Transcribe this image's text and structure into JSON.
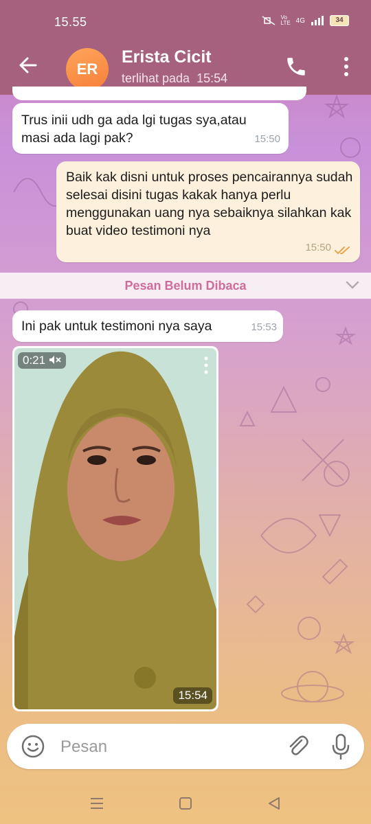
{
  "status_bar": {
    "time": "15.55",
    "battery": "34",
    "network": "4G",
    "volte": "Vo LTE"
  },
  "header": {
    "back_icon": "arrow-left-icon",
    "avatar_initials": "ER",
    "name": "Erista Cicit",
    "last_seen_label": "terlihat pada",
    "last_seen_time": "15:54",
    "call_icon": "phone-icon",
    "menu_icon": "more-vertical-icon"
  },
  "messages": [
    {
      "direction": "in",
      "text": "Trus inii udh ga ada lgi tugas sya,atau masi ada lagi pak?",
      "time": "15:50"
    },
    {
      "direction": "out",
      "text": "Baik kak disni untuk proses pencairannya sudah selesai disini tugas kakak hanya perlu menggunakan uang nya sebaiknya silahkan kak buat video testimoni nya",
      "time": "15:50",
      "read": true
    },
    {
      "direction": "in",
      "text": "Ini pak untuk testimoni nya saya",
      "time": "15:53"
    }
  ],
  "unread_divider": "Pesan Belum Dibaca",
  "video": {
    "duration": "0:21",
    "muted": true,
    "time": "15:54"
  },
  "input": {
    "placeholder": "Pesan",
    "value": ""
  },
  "colors": {
    "header": "#a5617d",
    "accent": "#cf6c9c",
    "avatar": "#f6803a",
    "read_check": "#e8a44a"
  }
}
